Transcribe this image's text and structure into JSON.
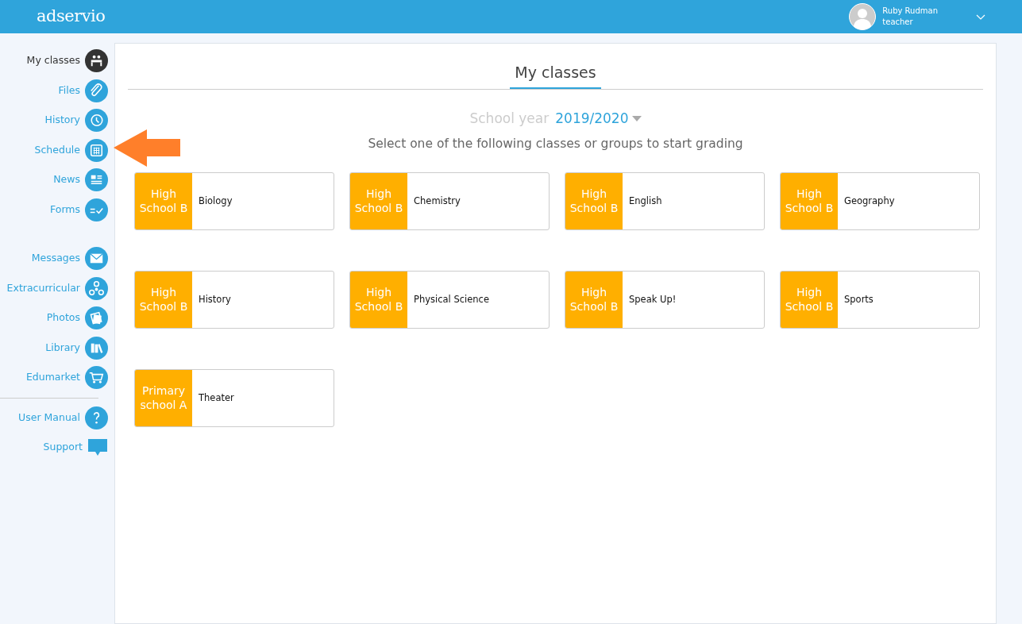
{
  "header": {
    "logo": "adservio",
    "user": {
      "name": "Ruby Rudman",
      "role": "teacher"
    }
  },
  "sidebar": {
    "groups": [
      {
        "items": [
          {
            "label": "My classes",
            "selected": true
          },
          {
            "label": "Files",
            "selected": false
          },
          {
            "label": "History",
            "selected": false
          },
          {
            "label": "Schedule",
            "selected": false
          },
          {
            "label": "News",
            "selected": false
          },
          {
            "label": "Forms",
            "selected": false
          }
        ]
      },
      {
        "items": [
          {
            "label": "Messages",
            "selected": false
          },
          {
            "label": "Extracurricular",
            "selected": false
          },
          {
            "label": "Photos",
            "selected": false
          },
          {
            "label": "Library",
            "selected": false
          },
          {
            "label": "Edumarket",
            "selected": false
          }
        ]
      },
      {
        "items": [
          {
            "label": "User Manual",
            "selected": false
          },
          {
            "label": "Support",
            "selected": false
          }
        ]
      }
    ]
  },
  "main": {
    "title": "My classes",
    "school_year_label": "School year",
    "school_year": "2019/2020",
    "instruction": "Select one of the following classes or groups to start grading",
    "classes": [
      {
        "group": "High School B",
        "subject": "Biology"
      },
      {
        "group": "High School B",
        "subject": "Chemistry"
      },
      {
        "group": "High School B",
        "subject": "English"
      },
      {
        "group": "High School B",
        "subject": "Geography"
      },
      {
        "group": "High School B",
        "subject": "History"
      },
      {
        "group": "High School B",
        "subject": "Physical Science"
      },
      {
        "group": "High School B",
        "subject": "Speak Up!"
      },
      {
        "group": "High School B",
        "subject": "Sports"
      },
      {
        "group": "Primary school A",
        "subject": "Theater"
      }
    ]
  }
}
